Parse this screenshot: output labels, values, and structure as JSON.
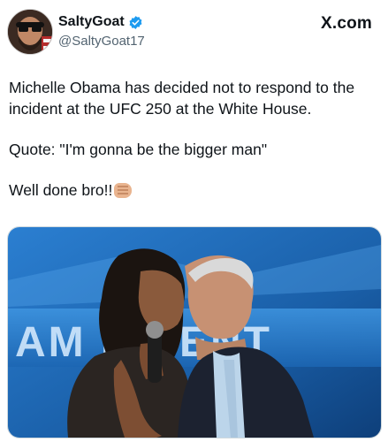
{
  "author": {
    "display_name": "SaltyGoat",
    "handle": "@SaltyGoat17",
    "verified": true,
    "avatar_icon": "bearded-man-avatar"
  },
  "source": {
    "label": "X.com"
  },
  "post": {
    "paragraphs": [
      "Michelle Obama has decided not to respond to the incident at the UFC 250 at the White House.",
      "Quote:  \"I'm gonna be the bigger man\"",
      "Well done bro!!"
    ],
    "emoji": "fist-bump-emoji"
  },
  "media": {
    "banner_text": "AM        RE        ENT",
    "background_color": "#1a5fa8"
  },
  "colors": {
    "verified": "#1d9bf0",
    "handle": "#536471",
    "text": "#0f1419"
  }
}
